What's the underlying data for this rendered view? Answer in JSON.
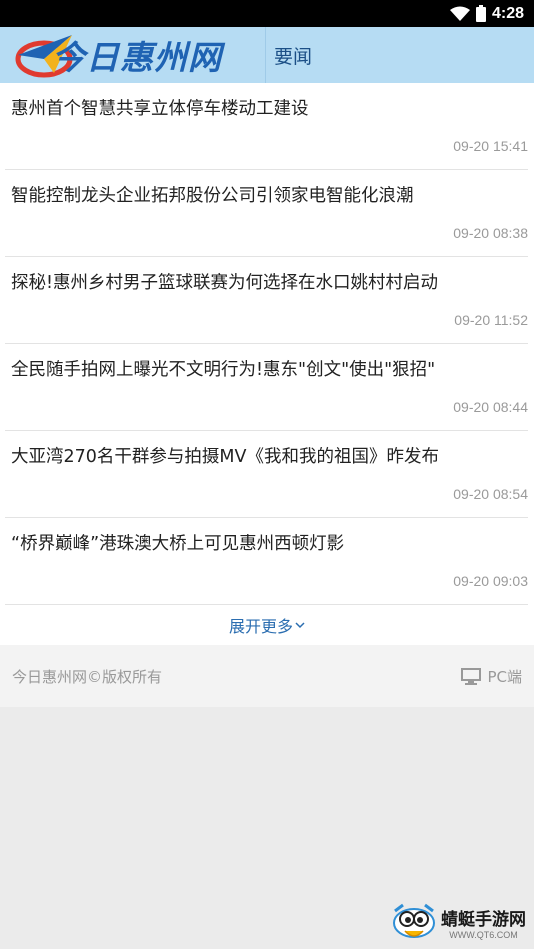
{
  "status_bar": {
    "time": "4:28"
  },
  "header": {
    "logo_text": "今日惠州网",
    "section_title": "要闻"
  },
  "news": [
    {
      "title": "惠州首个智慧共享立体停车楼动工建设",
      "time": "09-20 15:41"
    },
    {
      "title": "智能控制龙头企业拓邦股份公司引领家电智能化浪潮",
      "time": "09-20 08:38"
    },
    {
      "title": "探秘!惠州乡村男子篮球联赛为何选择在水口姚村村启动",
      "time": "09-20 11:52"
    },
    {
      "title": "全民随手拍网上曝光不文明行为!惠东\"创文\"使出\"狠招\"",
      "time": "09-20 08:44"
    },
    {
      "title": "大亚湾270名干群参与拍摄MV《我和我的祖国》昨发布",
      "time": "09-20 08:54"
    },
    {
      "title": "“桥界巅峰”港珠澳大桥上可见惠州西顿灯影",
      "time": "09-20 09:03"
    }
  ],
  "more_label": "展开更多",
  "footer": {
    "copyright": "今日惠州网©版权所有",
    "pc_label": "PC端"
  },
  "watermark": {
    "name": "蜻蜓手游网",
    "url": "WWW.QT6.COM"
  },
  "colors": {
    "header_bg": "#b6dcf3",
    "link_blue": "#2a6db0",
    "logo_blue": "#1f63b3"
  }
}
